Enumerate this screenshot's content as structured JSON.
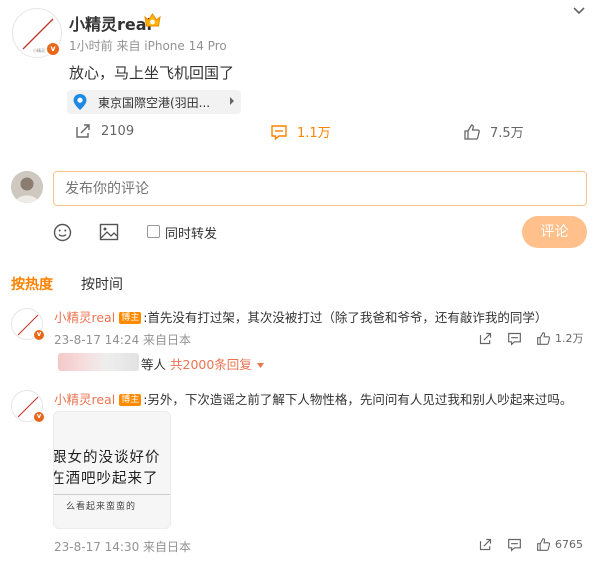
{
  "post": {
    "username": "小精灵real",
    "meta": "1小时前 来自 iPhone 14 Pro",
    "text": "放心，马上坐飞机回国了",
    "location": "東京国際空港(羽田...",
    "actions": {
      "repost_count": "2109",
      "comment_count": "1.1万",
      "like_count": "7.5万"
    }
  },
  "composer": {
    "placeholder": "发布你的评论",
    "repost_label": "同时转发",
    "submit_label": "评论"
  },
  "tabs": {
    "hot": "按热度",
    "time": "按时间"
  },
  "comments": [
    {
      "username": "小精灵real",
      "badge": "博主",
      "text": ":首先没有打过架，其次没被打过（除了我爸和爷爷，还有敲诈我的同学）",
      "meta": "23-8-17 14:24 来自日本",
      "like_count": "1.2万",
      "reply_suffix": "等人",
      "reply_count": "共2000条回复"
    },
    {
      "username": "小精灵real",
      "badge": "博主",
      "text": ":另外，下次造谣之前了解下人物性格，先问问有人见过我和别人吵起来过吗。",
      "meta": "23-8-17 14:30 来自日本",
      "like_count": "6765",
      "image_text": {
        "line1": "跟女的没谈好价",
        "line2": "在酒吧吵起来了",
        "line3": "么看起来蛮蛮的"
      }
    }
  ],
  "colors": {
    "accent": "#ff8200",
    "name_link": "#eb7350",
    "submit_bg": "#ffc08c",
    "input_border": "#ffc38a",
    "verified_badge": "#e8671a"
  }
}
